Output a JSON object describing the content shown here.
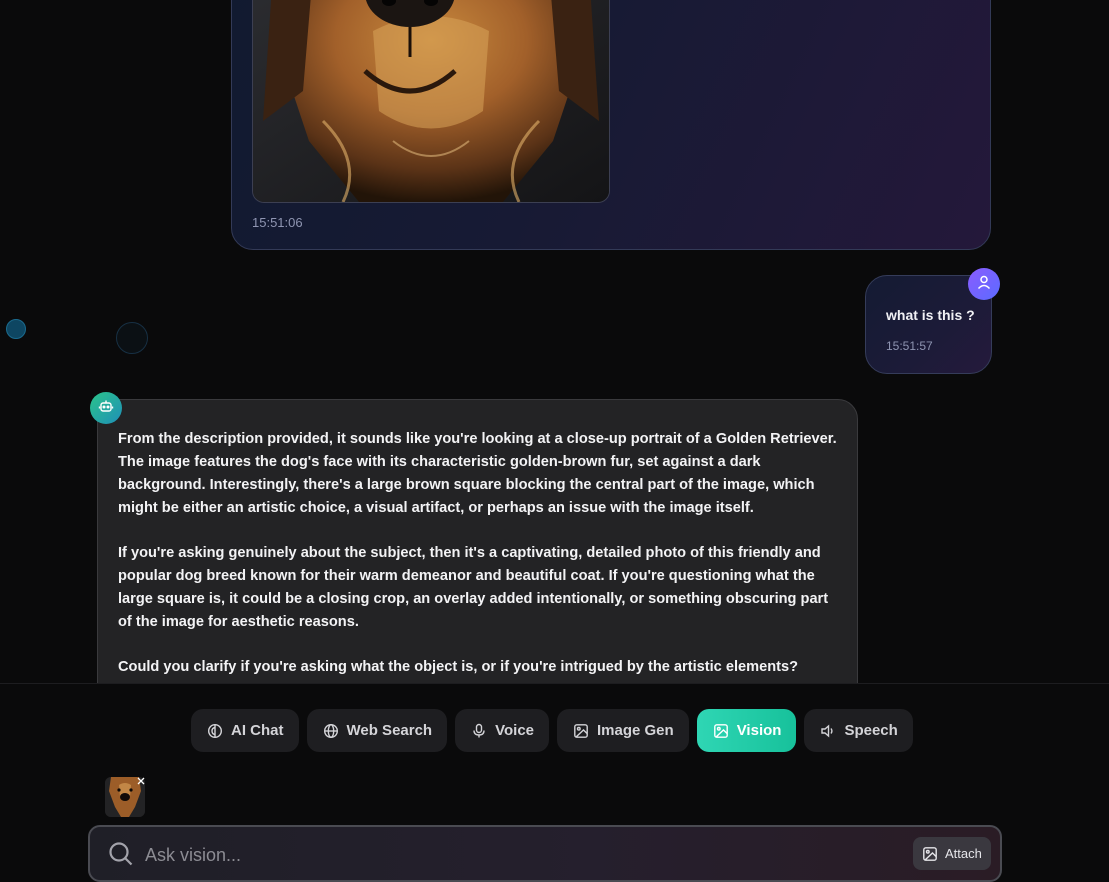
{
  "messages": {
    "image_message": {
      "timestamp": "15:51:06"
    },
    "user_message": {
      "text": "what is this ?",
      "timestamp": "15:51:57"
    },
    "assistant_message": {
      "paragraphs": [
        "From the description provided, it sounds like you're looking at a close-up portrait of a Golden Retriever. The image features the dog's face with its characteristic golden-brown fur, set against a dark background. Interestingly, there's a large brown square blocking the central part of the image, which might be either an artistic choice, a visual artifact, or perhaps an issue with the image itself.",
        "If you're asking genuinely about the subject, then it's a captivating, detailed photo of this friendly and popular dog breed known for their warm demeanor and beautiful coat. If you're questioning what the large square is, it could be a closing crop, an overlay added intentionally, or something obscuring part of the image for aesthetic reasons.",
        "Could you clarify if you're asking what the object is, or if you're intrigued by the artistic elements?"
      ]
    }
  },
  "modes": [
    {
      "label": "AI Chat",
      "icon": "brain-icon",
      "active": false
    },
    {
      "label": "Web Search",
      "icon": "globe-icon",
      "active": false
    },
    {
      "label": "Voice",
      "icon": "mic-icon",
      "active": false
    },
    {
      "label": "Image Gen",
      "icon": "image-icon",
      "active": false
    },
    {
      "label": "Vision",
      "icon": "image-icon",
      "active": true
    },
    {
      "label": "Speech",
      "icon": "speaker-icon",
      "active": false
    }
  ],
  "composer": {
    "placeholder": "Ask vision...",
    "attach_label": "Attach"
  },
  "colors": {
    "background": "#0a0a0b",
    "accent": "#1fcba6",
    "user_avatar": "#7a5cff",
    "bot_avatar": "#2bb58f"
  }
}
